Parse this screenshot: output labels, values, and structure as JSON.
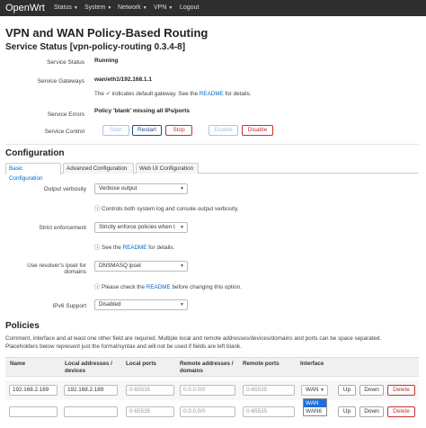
{
  "nav": {
    "brand": "OpenWrt",
    "items": [
      "Status",
      "System",
      "Network",
      "VPN",
      "Logout"
    ]
  },
  "page": {
    "title": "VPN and WAN Policy-Based Routing",
    "status_heading": "Service Status [vpn-policy-routing 0.3.4-8]"
  },
  "status": {
    "service_status_label": "Service Status",
    "service_status_value": "Running",
    "gateways_label": "Service Gateways",
    "gateways_value": "wan/eth1/192.168.1.1",
    "gateways_note_pre": "The ✓ indicates default gateway. See the ",
    "gateways_note_link": "README",
    "gateways_note_post": " for details.",
    "errors_label": "Service Errors",
    "errors_value": "Policy 'blank' missing all IPs/ports",
    "control_label": "Service Control",
    "buttons": {
      "start": "Start",
      "restart": "Restart",
      "stop": "Stop",
      "enable": "Enable",
      "disable": "Disable"
    }
  },
  "config": {
    "heading": "Configuration",
    "tabs": [
      "Basic Configuration",
      "Advanced Configuration",
      "Web UI Configuration"
    ],
    "verbosity_label": "Output verbosity",
    "verbosity_value": "Verbose output",
    "verbosity_note": "Controls both system log and console output verbosity.",
    "strict_label": "Strict enforcement",
    "strict_value": "Strictly enforce policies when t",
    "strict_note_pre": "See the ",
    "strict_note_link": "README",
    "strict_note_post": " for details.",
    "ipset_label_1": "Use resolver's ipset for",
    "ipset_label_2": "domains",
    "ipset_value": "DNSMASQ ipset",
    "ipset_note_pre": "Please check the ",
    "ipset_note_link": "README",
    "ipset_note_post": " before changing this option.",
    "ipv6_label": "IPv6 Support",
    "ipv6_value": "Disabled"
  },
  "policies": {
    "heading": "Policies",
    "desc_1": "Comment, interface and at least one other field are required. Multiple local and remote addresses/devices/domains and ports can be space separated.",
    "desc_2": "Placeholders below represent just the format/syntax and will not be used if fields are left blank.",
    "columns": {
      "name": "Name",
      "local_addr_1": "Local addresses /",
      "local_addr_2": "devices",
      "local_ports": "Local ports",
      "remote_addr_1": "Remote addresses /",
      "remote_addr_2": "domains",
      "remote_ports": "Remote ports",
      "interface": "Interface"
    },
    "rows": [
      {
        "name": "192.168.2.189",
        "local": "192.168.2.189",
        "local_ports": "0-65535",
        "remote": "0.0.0.0/0",
        "remote_ports": "0-65535",
        "interface": "WAN"
      },
      {
        "name": "",
        "local": "",
        "local_ports": "0-65535",
        "remote": "0.0.0.0/0",
        "remote_ports": "0-65535",
        "interface": "WAN"
      }
    ],
    "row_buttons": {
      "up": "Up",
      "down": "Down",
      "delete": "Delete"
    },
    "dropdown_options": [
      "WAN",
      "WAN6"
    ]
  }
}
